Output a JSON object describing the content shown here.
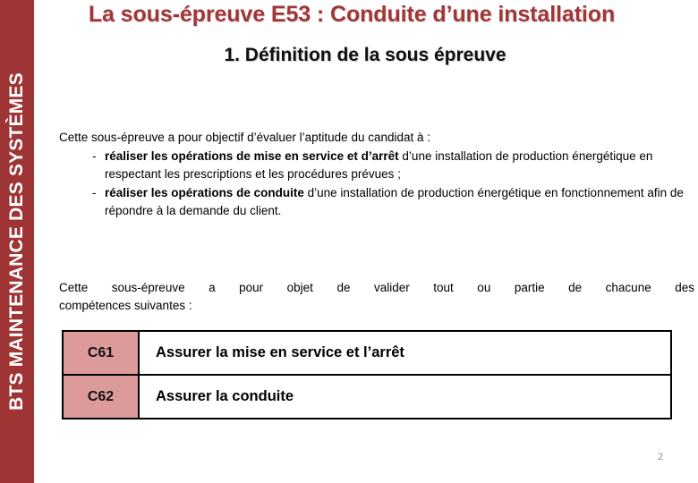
{
  "sidebar": {
    "label": "BTS MAINTENANCE DES SYSTÈMES",
    "background_color": "#9E3434",
    "text_color": "#FFFFFF"
  },
  "slide": {
    "title": "La sous-épreuve E53 : Conduite d’une installation",
    "title_color": "#9E3737",
    "subtitle": "1. Définition de la sous épreuve",
    "subtitle_color": "#111111",
    "page_number": "2"
  },
  "intro": {
    "lead": "Cette sous-épreuve a pour objectif d’évaluer l’aptitude du candidat à :",
    "bullets": [
      {
        "marker": "-",
        "bold": "réaliser les opérations de mise en service et d’arrêt",
        "rest": " d’une installation de production énergétique en respectant les prescriptions et les procédures prévues ;"
      },
      {
        "marker": "-",
        "bold": "réaliser les opérations de conduite",
        "rest": " d’une installation de production énergétique en fonctionnement afin de répondre à la demande du client."
      }
    ]
  },
  "objet": {
    "line_1": "Cette sous-épreuve a pour objet de valider tout ou partie de chacune des",
    "line_2": "compétences suivantes :"
  },
  "competency_table": {
    "code_cell_color": "#DD9A9A",
    "border_color": "#000000",
    "rows": [
      {
        "code": "C61",
        "label": "Assurer la mise en service et l’arrêt"
      },
      {
        "code": "C62",
        "label": "Assurer la conduite"
      }
    ]
  }
}
